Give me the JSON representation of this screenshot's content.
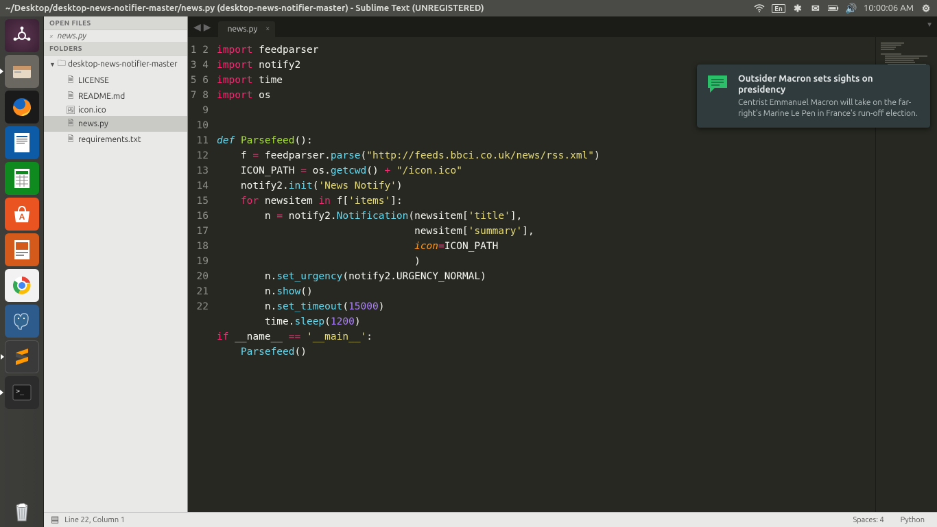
{
  "menubar": {
    "title": "~/Desktop/desktop-news-notifier-master/news.py (desktop-news-notifier-master) - Sublime Text (UNREGISTERED)",
    "lang": "En",
    "clock": "10:00:06 AM"
  },
  "launcher": {
    "items": [
      {
        "id": "dash",
        "name": "dash-home-icon"
      },
      {
        "id": "files",
        "name": "files-icon"
      },
      {
        "id": "firefox",
        "name": "firefox-icon"
      },
      {
        "id": "writer",
        "name": "writer-icon"
      },
      {
        "id": "calc",
        "name": "calc-icon"
      },
      {
        "id": "store",
        "name": "software-center-icon"
      },
      {
        "id": "impress",
        "name": "impress-icon"
      },
      {
        "id": "chrome",
        "name": "chrome-icon"
      },
      {
        "id": "pg",
        "name": "postgresql-icon"
      },
      {
        "id": "sublime",
        "name": "sublime-icon"
      },
      {
        "id": "terminal",
        "name": "terminal-icon"
      }
    ]
  },
  "sidebar": {
    "open_files_label": "OPEN FILES",
    "folders_label": "FOLDERS",
    "open_file": "news.py",
    "project": "desktop-news-notifier-master",
    "files": [
      {
        "label": "LICENSE",
        "icon": "file"
      },
      {
        "label": "README.md",
        "icon": "md"
      },
      {
        "label": "icon.ico",
        "icon": "img"
      },
      {
        "label": "news.py",
        "icon": "file",
        "selected": true
      },
      {
        "label": "requirements.txt",
        "icon": "file"
      }
    ]
  },
  "tabs": {
    "active": "news.py"
  },
  "code": {
    "lines": 22,
    "status_line": "Line 22, Column 1",
    "spaces_label": "Spaces: 4",
    "syntax": "Python"
  },
  "code_tokens": [
    [
      [
        "kw",
        "import"
      ],
      [
        "p",
        " feedparser"
      ]
    ],
    [
      [
        "kw",
        "import"
      ],
      [
        "p",
        " notify2"
      ]
    ],
    [
      [
        "kw",
        "import"
      ],
      [
        "p",
        " time"
      ]
    ],
    [
      [
        "kw",
        "import"
      ],
      [
        "p",
        " os"
      ]
    ],
    [],
    [],
    [
      [
        "kw2",
        "def"
      ],
      [
        "p",
        " "
      ],
      [
        "fn",
        "Parsefeed"
      ],
      [
        "p",
        "():"
      ]
    ],
    [
      [
        "p",
        "    f "
      ],
      [
        "op",
        "="
      ],
      [
        "p",
        " feedparser"
      ],
      [
        "p",
        "."
      ],
      [
        "fncall",
        "parse"
      ],
      [
        "p",
        "("
      ],
      [
        "str",
        "\"http://feeds.bbci.co.uk/news/rss.xml\""
      ],
      [
        "p",
        ")"
      ]
    ],
    [
      [
        "p",
        "    ICON_PATH "
      ],
      [
        "op",
        "="
      ],
      [
        "p",
        " os"
      ],
      [
        "p",
        "."
      ],
      [
        "fncall",
        "getcwd"
      ],
      [
        "p",
        "() "
      ],
      [
        "op",
        "+"
      ],
      [
        "p",
        " "
      ],
      [
        "str",
        "\"/icon.ico\""
      ]
    ],
    [
      [
        "p",
        "    notify2"
      ],
      [
        "p",
        "."
      ],
      [
        "fncall",
        "init"
      ],
      [
        "p",
        "("
      ],
      [
        "str",
        "'News Notify'"
      ],
      [
        "p",
        ")"
      ]
    ],
    [
      [
        "p",
        "    "
      ],
      [
        "kw",
        "for"
      ],
      [
        "p",
        " newsitem "
      ],
      [
        "kw",
        "in"
      ],
      [
        "p",
        " f["
      ],
      [
        "str",
        "'items'"
      ],
      [
        "p",
        "]:"
      ]
    ],
    [
      [
        "p",
        "        n "
      ],
      [
        "op",
        "="
      ],
      [
        "p",
        " notify2"
      ],
      [
        "p",
        "."
      ],
      [
        "fncall",
        "Notification"
      ],
      [
        "p",
        "(newsitem["
      ],
      [
        "str",
        "'title'"
      ],
      [
        "p",
        "],"
      ]
    ],
    [
      [
        "p",
        "                                 newsitem["
      ],
      [
        "str",
        "'summary'"
      ],
      [
        "p",
        "],"
      ]
    ],
    [
      [
        "p",
        "                                 "
      ],
      [
        "arg",
        "icon"
      ],
      [
        "op",
        "="
      ],
      [
        "p",
        "ICON_PATH"
      ]
    ],
    [
      [
        "p",
        "                                 )"
      ]
    ],
    [
      [
        "p",
        "        n"
      ],
      [
        "p",
        "."
      ],
      [
        "fncall",
        "set_urgency"
      ],
      [
        "p",
        "(notify2"
      ],
      [
        "p",
        "."
      ],
      [
        "p",
        "URGENCY_NORMAL)"
      ]
    ],
    [
      [
        "p",
        "        n"
      ],
      [
        "p",
        "."
      ],
      [
        "fncall",
        "show"
      ],
      [
        "p",
        "()"
      ]
    ],
    [
      [
        "p",
        "        n"
      ],
      [
        "p",
        "."
      ],
      [
        "fncall",
        "set_timeout"
      ],
      [
        "p",
        "("
      ],
      [
        "num",
        "15000"
      ],
      [
        "p",
        ")"
      ]
    ],
    [
      [
        "p",
        "        time"
      ],
      [
        "p",
        "."
      ],
      [
        "fncall",
        "sleep"
      ],
      [
        "p",
        "("
      ],
      [
        "num",
        "1200"
      ],
      [
        "p",
        ")"
      ]
    ],
    [
      [
        "kw",
        "if"
      ],
      [
        "p",
        " __name__ "
      ],
      [
        "op",
        "=="
      ],
      [
        "p",
        " "
      ],
      [
        "str",
        "'__main__'"
      ],
      [
        "p",
        ":"
      ]
    ],
    [
      [
        "p",
        "    "
      ],
      [
        "fncall",
        "Parsefeed"
      ],
      [
        "p",
        "()"
      ]
    ],
    []
  ],
  "notification": {
    "title": "Outsider Macron sets sights on presidency",
    "body": "Centrist Emmanuel Macron will take on the far-right's Marine Le Pen in France's run-off election."
  }
}
